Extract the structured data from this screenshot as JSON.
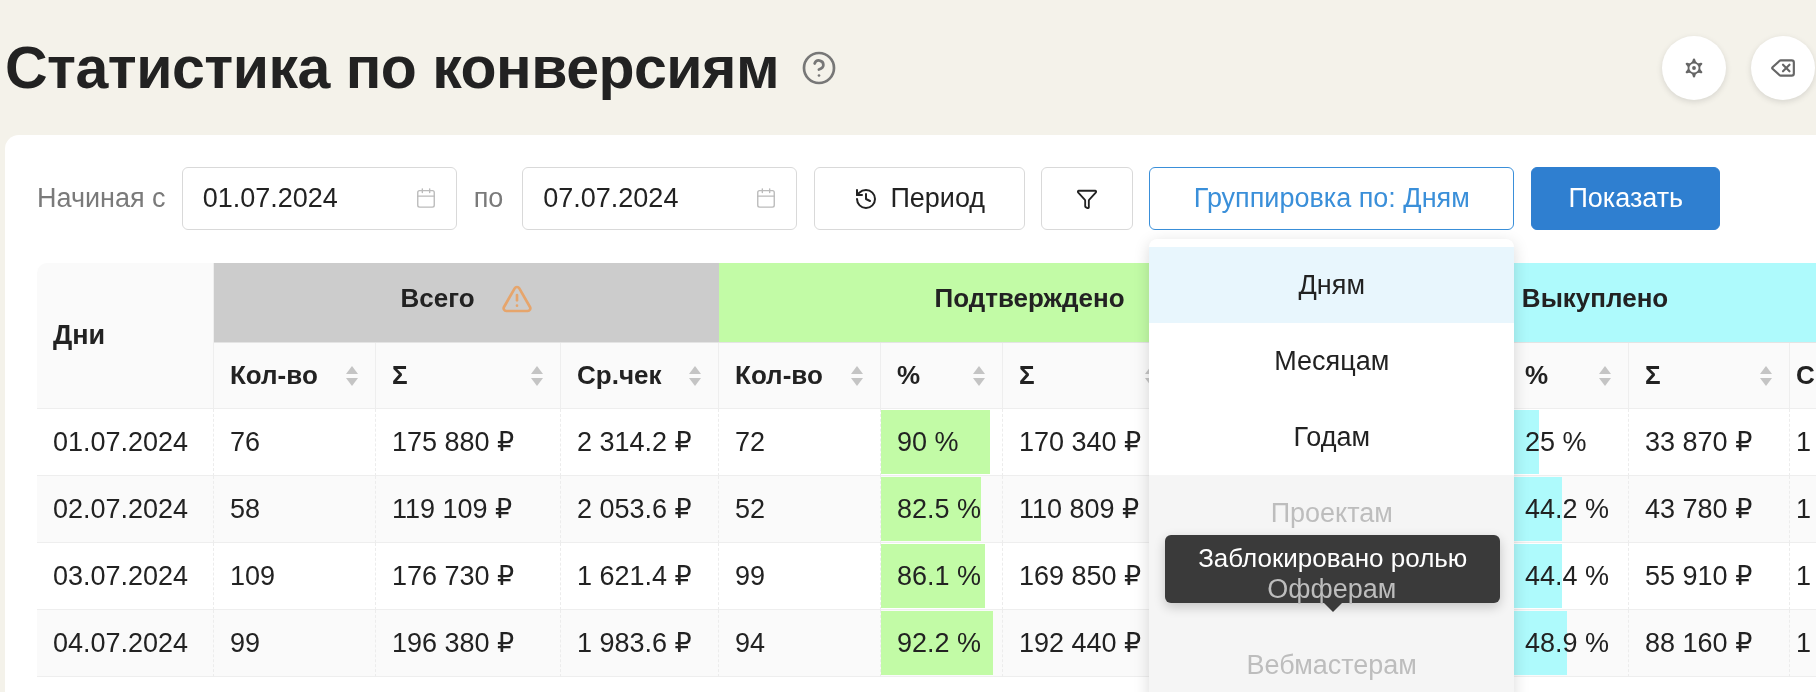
{
  "page": {
    "title": "Статистика по конверсиям"
  },
  "filters": {
    "start_label": "Начиная с",
    "start_date": "01.07.2024",
    "end_label": "по",
    "end_date": "07.07.2024",
    "period_button": "Период",
    "grouping_button": "Группировка по: Дням",
    "submit_button": "Показать"
  },
  "grouping_menu": {
    "open": true,
    "items": [
      {
        "label": "Дням",
        "selected": true,
        "disabled": false
      },
      {
        "label": "Месяцам",
        "selected": false,
        "disabled": false
      },
      {
        "label": "Годам",
        "selected": false,
        "disabled": false
      },
      {
        "label": "Проектам",
        "selected": false,
        "disabled": true
      },
      {
        "label": "Офферам",
        "selected": false,
        "disabled": true
      },
      {
        "label": "Вебмастерам",
        "selected": false,
        "disabled": true
      }
    ],
    "tooltip": "Заблокировано ролью"
  },
  "table": {
    "first_column": "Дни",
    "groups": [
      {
        "label": "Всего",
        "color": "#cccccc",
        "warning": true,
        "columns": [
          {
            "label": "Кол-во",
            "kind": "text",
            "sortable": true
          },
          {
            "label": "Σ",
            "kind": "text",
            "sortable": true
          },
          {
            "label": "Ср.чек",
            "kind": "text",
            "sortable": true
          }
        ]
      },
      {
        "label": "Подтверждено",
        "color": "#c2fba6",
        "warning": false,
        "columns": [
          {
            "label": "Кол-во",
            "kind": "text",
            "sortable": true
          },
          {
            "label": "%",
            "kind": "bar",
            "sortable": true
          },
          {
            "label": "Σ",
            "kind": "text",
            "sortable": true
          },
          {
            "kind": "covered"
          }
        ]
      },
      {
        "label": "Выкуплено",
        "color": "#aefafc",
        "warning": false,
        "columns": [
          {
            "kind": "covered"
          },
          {
            "label": "%",
            "kind": "bar",
            "sortable": true
          },
          {
            "label": "Σ",
            "kind": "text",
            "sortable": true
          },
          {
            "label": "С",
            "kind": "text",
            "sortable": false
          }
        ]
      }
    ],
    "rows": [
      {
        "date": "01.07.2024",
        "cells": [
          "76",
          "175 880 ₽",
          "2 314.2 ₽",
          "72",
          {
            "text": "90 %",
            "level": 0.9
          },
          "170 340 ₽",
          null,
          null,
          {
            "text": "25 %",
            "level": 0.25
          },
          "33 870 ₽",
          "1"
        ]
      },
      {
        "date": "02.07.2024",
        "cells": [
          "58",
          "119 109 ₽",
          "2 053.6 ₽",
          "52",
          {
            "text": "82.5 %",
            "level": 0.825
          },
          "110 809 ₽",
          null,
          null,
          {
            "text": "44.2 %",
            "level": 0.442
          },
          "43 780 ₽",
          "1"
        ]
      },
      {
        "date": "03.07.2024",
        "cells": [
          "109",
          "176 730 ₽",
          "1 621.4 ₽",
          "99",
          {
            "text": "86.1 %",
            "level": 0.861
          },
          "169 850 ₽",
          null,
          null,
          {
            "text": "44.4 %",
            "level": 0.444
          },
          "55 910 ₽",
          "1"
        ]
      },
      {
        "date": "04.07.2024",
        "cells": [
          "99",
          "196 380 ₽",
          "1 983.6 ₽",
          "94",
          {
            "text": "92.2 %",
            "level": 0.922
          },
          "192 440 ₽",
          null,
          null,
          {
            "text": "48.9 %",
            "level": 0.489
          },
          "88 160 ₽",
          "1"
        ]
      }
    ]
  }
}
